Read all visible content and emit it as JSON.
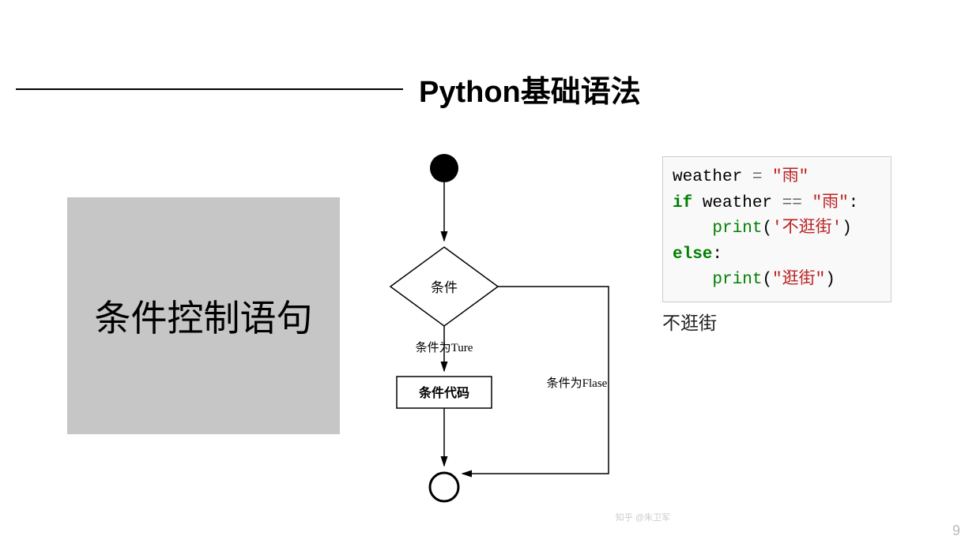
{
  "header": {
    "title": "Python基础语法"
  },
  "subtitle": "条件控制语句",
  "flowchart": {
    "condition_label": "条件",
    "true_label": "条件为Ture",
    "false_label": "条件为Flase",
    "code_block_label": "条件代码"
  },
  "code": {
    "line1_var": "weather ",
    "line1_assign": "= ",
    "line1_str": "\"雨\"",
    "line2_kw": "if",
    "line2_expr": " weather ",
    "line2_op": "==",
    "line2_str": " \"雨\"",
    "line2_colon": ":",
    "line3_indent": "    ",
    "line3_fn": "print",
    "line3_paren1": "(",
    "line3_str": "'不逛街'",
    "line3_paren2": ")",
    "line4_kw": "else",
    "line4_colon": ":",
    "line5_indent": "    ",
    "line5_fn": "print",
    "line5_paren1": "(",
    "line5_str": "\"逛街\"",
    "line5_paren2": ")"
  },
  "output": "不逛街",
  "page_number": "9",
  "watermark": "知乎 @朱卫军"
}
